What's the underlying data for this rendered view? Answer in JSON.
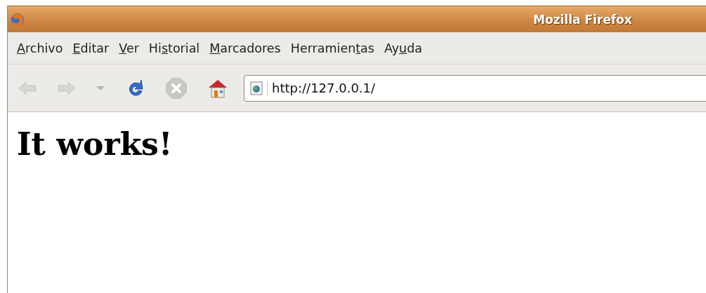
{
  "window": {
    "title": "Mozilla Firefox"
  },
  "menu": [
    {
      "key": "A",
      "post": "rchivo"
    },
    {
      "key": "E",
      "post": "ditar"
    },
    {
      "key": "V",
      "post": "er"
    },
    {
      "pre": "Hi",
      "key": "s",
      "post": "torial"
    },
    {
      "key": "M",
      "post": "arcadores"
    },
    {
      "pre": "Herramien",
      "key": "t",
      "post": "as"
    },
    {
      "pre": "Ay",
      "key": "u",
      "post": "da"
    }
  ],
  "toolbar": [
    {
      "kind": "back",
      "disabled": true
    },
    {
      "kind": "forward",
      "disabled": true
    },
    {
      "kind": "history",
      "disabled": true
    },
    {
      "kind": "reload",
      "disabled": false
    },
    {
      "kind": "stop",
      "disabled": true
    },
    {
      "kind": "home",
      "disabled": false
    }
  ],
  "address": {
    "value": "http://127.0.0.1/"
  },
  "page": {
    "heading": "It works!"
  }
}
